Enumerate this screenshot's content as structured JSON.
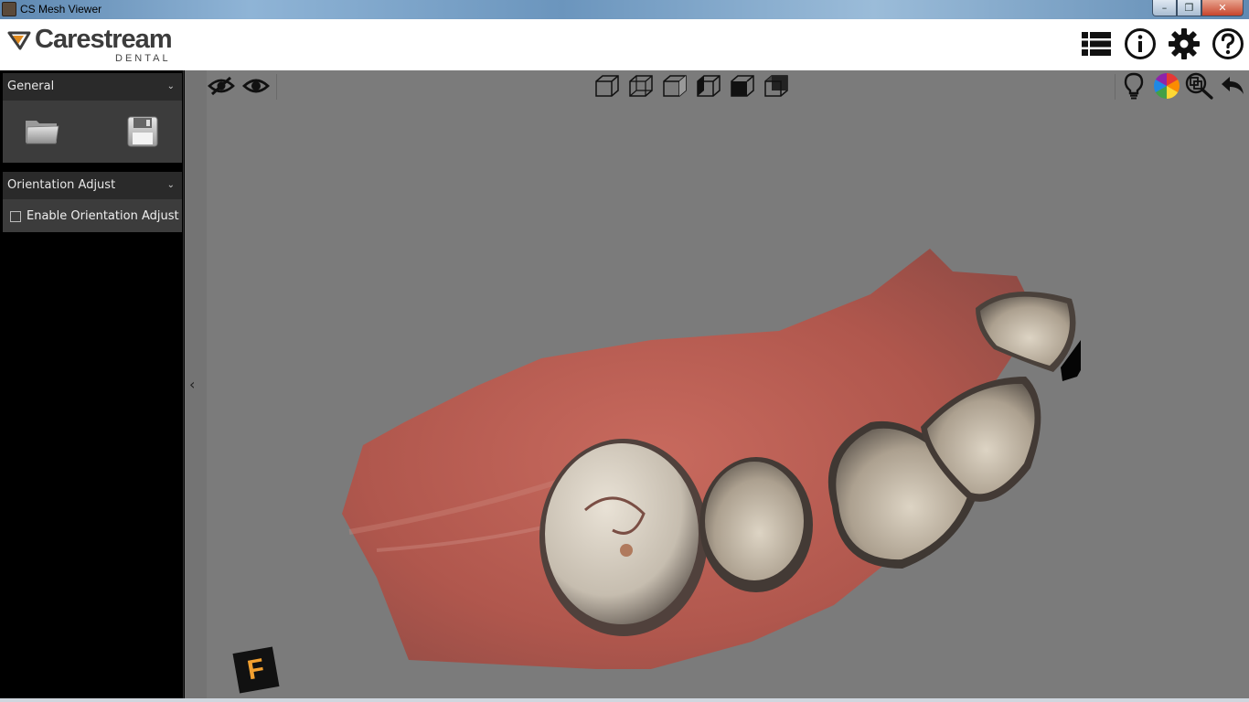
{
  "window": {
    "title": "CS Mesh Viewer",
    "minimize": "–",
    "maximize": "❐",
    "close": "✕"
  },
  "header": {
    "brand": "Carestream",
    "subbrand": "DENTAL"
  },
  "header_icons": [
    "list-icon",
    "info-icon",
    "gear-icon",
    "help-icon"
  ],
  "sidebar": {
    "general": {
      "label": "General",
      "chevron": "⌄",
      "tools": [
        "open-folder-icon",
        "save-icon"
      ]
    },
    "orientation": {
      "label": "Orientation Adjust",
      "chevron": "⌄",
      "checkbox_label": "Enable Orientation Adjust",
      "checked": false
    }
  },
  "viewer": {
    "collapse_glyph": "‹",
    "toolbar_left": [
      "hide-icon",
      "show-icon"
    ],
    "toolbar_center": [
      "view-cube-front",
      "view-cube-left",
      "view-cube-right",
      "view-cube-back",
      "view-cube-top",
      "view-cube-bottom"
    ],
    "toolbar_right": [
      "light-bulb-icon",
      "color-wheel-icon",
      "zoom-fit-icon",
      "undo-icon"
    ],
    "orientation_tag": "F"
  },
  "colors": {
    "viewer_bg": "#7b7b7b",
    "panel_head": "#2a2a2a",
    "panel_body": "#3c3c3c",
    "gum": "#b5544a",
    "tooth": "#c9bfae"
  }
}
